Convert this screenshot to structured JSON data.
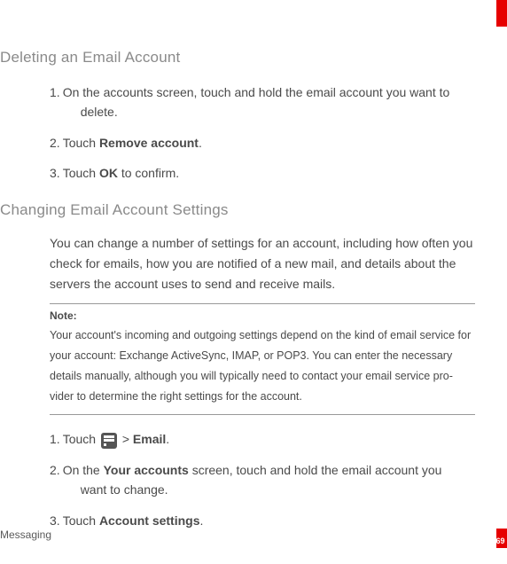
{
  "section1": {
    "heading": "Deleting an Email Account",
    "items": [
      {
        "num": "1.",
        "pre": "On the accounts screen, touch and hold the email account you want to",
        "cont": "delete."
      },
      {
        "num": "2.",
        "pre": "Touch ",
        "bold": "Remove account",
        "post": "."
      },
      {
        "num": "3.",
        "pre": "Touch ",
        "bold": "OK",
        "post": " to confirm."
      }
    ]
  },
  "section2": {
    "heading": "Changing Email Account Settings",
    "intro": "You can change a number of settings for an account, including how often you check for emails, how you are notified of a new mail, and details about the servers the account uses to send and receive mails.",
    "note_label": "Note:",
    "note_text": "Your account's incoming and outgoing settings depend on the kind of email service for your account: Exchange ActiveSync, IMAP, or POP3. You can enter the necessary details manually, although you will typically need to contact your email service pro-vider to determine the right settings for the account.",
    "items": [
      {
        "num": "1.",
        "pre": "Touch ",
        "mid": " > ",
        "bold": "Email",
        "post": "."
      },
      {
        "num": "2.",
        "pre": "On the ",
        "bold": "Your accounts",
        "post": " screen, touch and hold the email account you",
        "cont": "want to change."
      },
      {
        "num": "3.",
        "pre": "Touch ",
        "bold": "Account settings",
        "post": "."
      }
    ]
  },
  "footer": "Messaging",
  "page": "69"
}
